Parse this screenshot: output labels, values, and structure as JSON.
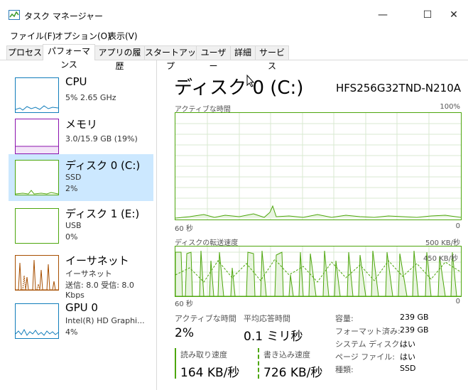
{
  "window": {
    "title": "タスク マネージャー",
    "minimize": "—",
    "maximize": "☐",
    "close": "✕"
  },
  "menu": [
    "ファイル(F)",
    "オプション(O)",
    "表示(V)"
  ],
  "tabs": [
    "プロセス",
    "パフォーマンス",
    "アプリの履歴",
    "スタートアップ",
    "ユーザー",
    "詳細",
    "サービス"
  ],
  "sidebar": [
    {
      "name": "CPU",
      "sub1": "5%  2.65 GHz",
      "sub2": "",
      "sub3": "",
      "color": "#117dbb"
    },
    {
      "name": "メモリ",
      "sub1": "3.0/15.9 GB (19%)",
      "sub2": "",
      "sub3": "",
      "color": "#8b12ae"
    },
    {
      "name": "ディスク 0 (C:)",
      "sub1": "SSD",
      "sub2": "2%",
      "sub3": "",
      "color": "#4da60c"
    },
    {
      "name": "ディスク 1 (E:)",
      "sub1": "USB",
      "sub2": "0%",
      "sub3": "",
      "color": "#4da60c"
    },
    {
      "name": "イーサネット",
      "sub1": "イーサネット",
      "sub2": "送信: 8.0  受信: 8.0 Kbps",
      "sub3": "",
      "color": "#a74f01"
    },
    {
      "name": "GPU 0",
      "sub1": "Intel(R) HD Graphi...",
      "sub2": "4%",
      "sub3": "",
      "color": "#117dbb"
    }
  ],
  "detail": {
    "title": "ディスク 0 (C:)",
    "model": "HFS256G32TND-N210A",
    "graph1": {
      "label": "アクティブな時間",
      "max": "100%",
      "time": "60 秒",
      "min": "0"
    },
    "graph2": {
      "label": "ディスクの転送速度",
      "max": "500 KB/秒",
      "mid": "450 KB/秒",
      "time": "60 秒",
      "min": "0"
    },
    "stats": {
      "active_label": "アクティブな時間",
      "active_value": "2%",
      "response_label": "平均応答時間",
      "response_value": "0.1 ミリ秒",
      "read_label": "読み取り速度",
      "read_value": "164 KB/秒",
      "write_label": "書き込み速度",
      "write_value": "726 KB/秒"
    },
    "props": [
      {
        "k": "容量:",
        "v": "239 GB"
      },
      {
        "k": "フォーマット済み:",
        "v": "239 GB"
      },
      {
        "k": "システム ディスク:",
        "v": "はい"
      },
      {
        "k": "ページ ファイル:",
        "v": "はい"
      },
      {
        "k": "種類:",
        "v": "SSD"
      }
    ]
  }
}
